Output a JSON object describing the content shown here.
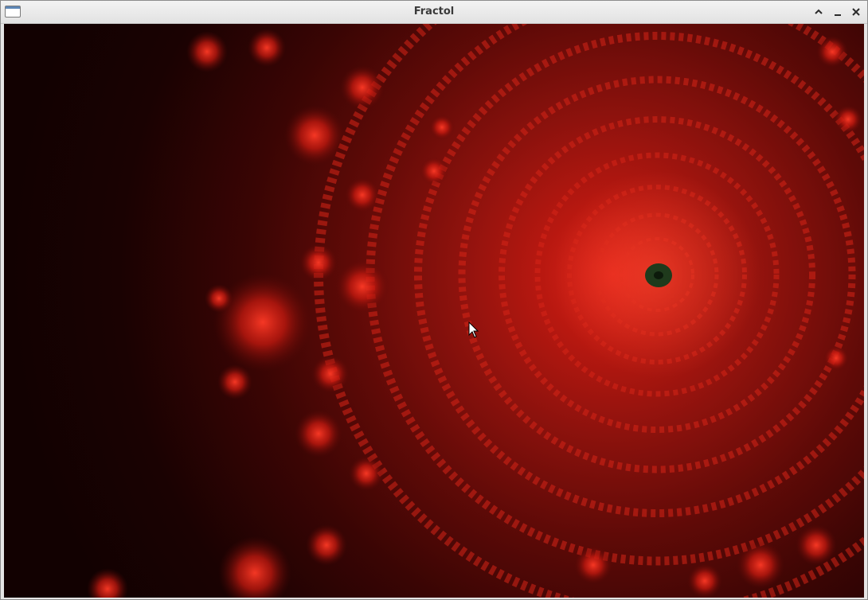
{
  "window": {
    "title": "Fractol"
  },
  "titlebar": {
    "icons": [
      "app-window-icon",
      "maximize-icon",
      "minimize-icon",
      "close-icon"
    ]
  },
  "canvas": {
    "content": "julia-fractal-render",
    "colors": {
      "background_dark": "#120101",
      "core_red": "#e0251a",
      "mid_red": "#8d120d",
      "center_dark_green": "#1f3a1c"
    }
  }
}
